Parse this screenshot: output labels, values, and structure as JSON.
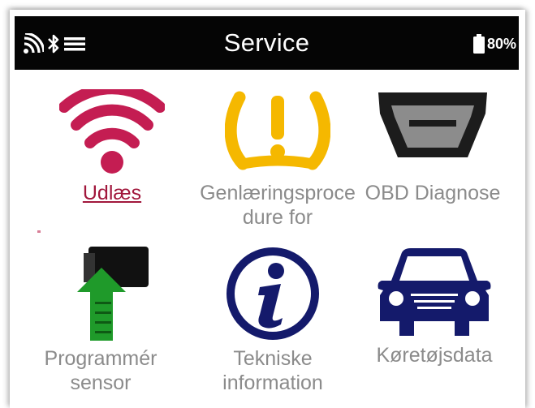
{
  "statusbar": {
    "title": "Service",
    "battery": "80%",
    "icons": [
      "signal-icon",
      "bluetooth-icon",
      "menu-icon",
      "battery-icon"
    ]
  },
  "menu": {
    "items": [
      {
        "label": "Udlæs",
        "icon": "wifi-read-icon",
        "active": true
      },
      {
        "label": "Genlæringsprocedure for",
        "icon": "tpms-warning-icon",
        "active": false
      },
      {
        "label": "OBD Diagnose",
        "icon": "obd-connector-icon",
        "active": false
      },
      {
        "label": "Programmér sensor",
        "icon": "program-sensor-icon",
        "active": false
      },
      {
        "label": "Tekniske information",
        "icon": "info-icon",
        "active": false
      },
      {
        "label": "Køretøjsdata",
        "icon": "car-icon",
        "active": false
      }
    ]
  },
  "colors": {
    "active_label": "#a1173c",
    "inactive_label": "#8b8b8b",
    "wifi": "#c41d52",
    "tpms": "#f5b800",
    "navy": "#141a6b",
    "arrow": "#1f9a2a"
  }
}
